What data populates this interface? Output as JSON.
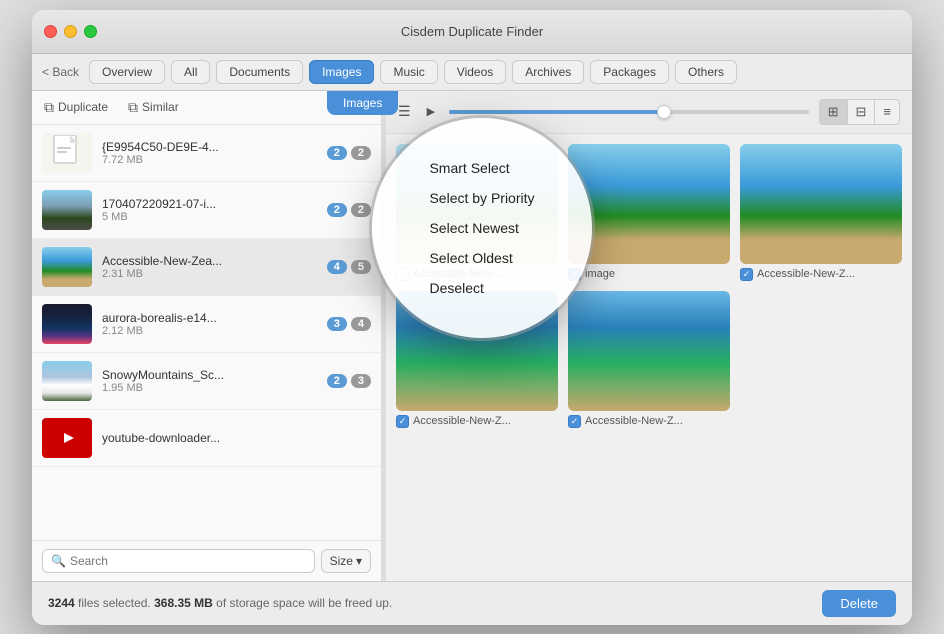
{
  "window": {
    "title": "Cisdem Duplicate Finder"
  },
  "titlebar": {
    "title": "Cisdem Duplicate Finder"
  },
  "topbar": {
    "back_label": "< Back",
    "tabs": [
      {
        "id": "overview",
        "label": "Overview",
        "active": false
      },
      {
        "id": "all",
        "label": "All",
        "active": false
      },
      {
        "id": "documents",
        "label": "Documents",
        "active": false
      },
      {
        "id": "images",
        "label": "Images",
        "active": true
      },
      {
        "id": "music",
        "label": "Music",
        "active": false
      },
      {
        "id": "videos",
        "label": "Videos",
        "active": false
      },
      {
        "id": "archives",
        "label": "Archives",
        "active": false
      },
      {
        "id": "packages",
        "label": "Packages",
        "active": false
      },
      {
        "id": "others",
        "label": "Others",
        "active": false
      }
    ],
    "active_tab_tooltip": "Images"
  },
  "sidebar": {
    "duplicate_label": "Duplicate",
    "similar_label": "Similar",
    "items": [
      {
        "name": "{E9954C50-DE9E-4...",
        "size": "7.72 MB",
        "badge1": "2",
        "badge2": "2",
        "type": "doc",
        "selected": false
      },
      {
        "name": "170407220921-07-i...",
        "size": "5 MB",
        "badge1": "2",
        "badge2": "2",
        "type": "mountain",
        "selected": false
      },
      {
        "name": "Accessible-New-Zea...",
        "size": "2.31 MB",
        "badge1": "4",
        "badge2": "5",
        "type": "beach",
        "selected": true
      },
      {
        "name": "aurora-borealis-e14...",
        "size": "2.12 MB",
        "badge1": "3",
        "badge2": "4",
        "type": "aurora",
        "selected": false
      },
      {
        "name": "SnowyMountains_Sc...",
        "size": "1.95 MB",
        "badge1": "2",
        "badge2": "3",
        "type": "snowy",
        "selected": false
      },
      {
        "name": "youtube-downloader...",
        "size": "",
        "badge1": "",
        "badge2": "",
        "type": "yt",
        "selected": false
      }
    ],
    "search_placeholder": "Search",
    "size_label": "Size"
  },
  "main": {
    "view_modes": [
      {
        "id": "grid-large",
        "icon": "⊞",
        "active": true
      },
      {
        "id": "grid-medium",
        "icon": "⊟",
        "active": false
      },
      {
        "id": "list",
        "icon": "≡",
        "active": false
      }
    ],
    "images": [
      {
        "label": "Accessible-New-...",
        "checked": false,
        "type": "beach"
      },
      {
        "label": "image",
        "checked": true,
        "type": "beach2"
      },
      {
        "label": "Accessible-New-Z...",
        "checked": true,
        "type": "beach3"
      },
      {
        "label": "Accessible-New-Z...",
        "checked": true,
        "type": "beach4"
      },
      {
        "label": "Accessible-New-Z...",
        "checked": true,
        "type": "beach5"
      }
    ]
  },
  "dropdown": {
    "items": [
      {
        "label": "Smart Select"
      },
      {
        "label": "Select by Priority"
      },
      {
        "label": "Select Newest"
      },
      {
        "label": "Select Oldest"
      },
      {
        "label": "Deselect"
      }
    ]
  },
  "statusbar": {
    "prefix": "",
    "count": "3244",
    "count_label": " files selected. ",
    "size": "368.35 MB",
    "size_label": " of storage space will be freed up.",
    "delete_label": "Delete"
  }
}
